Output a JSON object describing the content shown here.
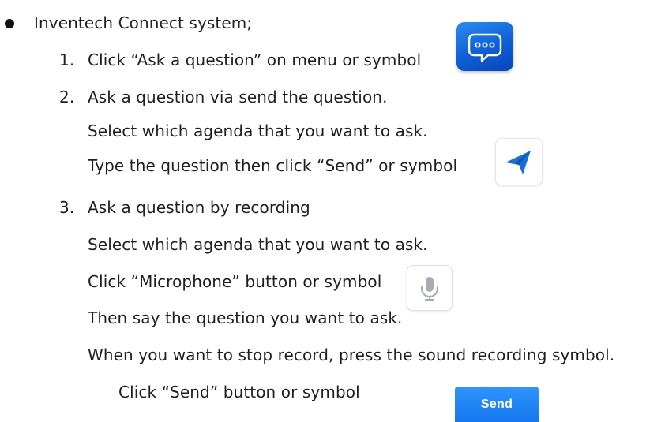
{
  "heading": "Inventech Connect system;",
  "steps": [
    {
      "number": "1.",
      "lines": [
        "Click “Ask a question” on menu or symbol"
      ]
    },
    {
      "number": "2.",
      "lines": [
        "Ask a question via send the question.",
        "Select which agenda that you want to ask.",
        "Type the question then click “Send” or symbol"
      ]
    },
    {
      "number": "3.",
      "lines": [
        "Ask a question by recording",
        "Select which agenda that you want to ask.",
        "Click “Microphone” button or symbol",
        "Then say the question you want to ask.",
        "When you want to stop record, press the sound recording symbol.",
        "Click “Send” button or symbol"
      ]
    }
  ],
  "icons": {
    "chat": "chat-bubble-icon",
    "send": "paper-plane-icon",
    "mic": "microphone-icon"
  },
  "send_button_label": "Send",
  "colors": {
    "chat_icon_bg": "#0f5fd6",
    "send_plane": "#1a73e8",
    "send_button_bg": "#1577ef"
  }
}
